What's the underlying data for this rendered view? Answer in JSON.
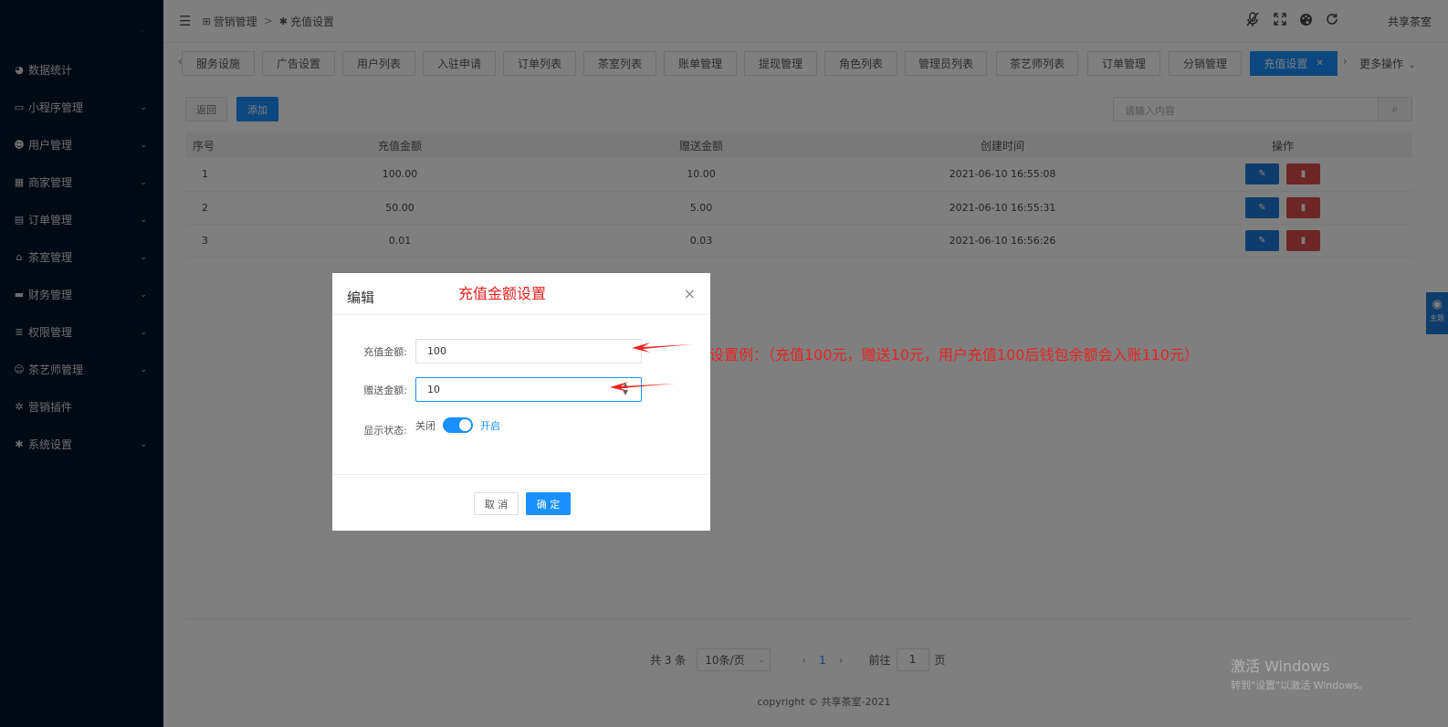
{
  "sidebar": {
    "logo_text": "·",
    "items": [
      {
        "label": "数据统计",
        "icon": "dashboard-icon",
        "glyph": "◕",
        "has_children": false
      },
      {
        "label": "小程序管理",
        "icon": "monitor-icon",
        "glyph": "▭",
        "has_children": true
      },
      {
        "label": "用户管理",
        "icon": "users-icon",
        "glyph": "☻",
        "has_children": true
      },
      {
        "label": "商家管理",
        "icon": "store-icon",
        "glyph": "▦",
        "has_children": true
      },
      {
        "label": "订单管理",
        "icon": "clipboard-icon",
        "glyph": "▤",
        "has_children": true
      },
      {
        "label": "茶室管理",
        "icon": "home-icon",
        "glyph": "⌂",
        "has_children": true
      },
      {
        "label": "财务管理",
        "icon": "credit-card-icon",
        "glyph": "▬",
        "has_children": true
      },
      {
        "label": "权限管理",
        "icon": "database-icon",
        "glyph": "≣",
        "has_children": true
      },
      {
        "label": "茶艺师管理",
        "icon": "user-tie-icon",
        "glyph": "☺",
        "has_children": true
      },
      {
        "label": "营销插件",
        "icon": "plugin-icon",
        "glyph": "✲",
        "has_children": false
      },
      {
        "label": "系统设置",
        "icon": "gear-icon",
        "glyph": "✱",
        "has_children": true
      }
    ]
  },
  "header": {
    "breadcrumb": [
      {
        "label": "营销管理",
        "icon": "sitemap-icon",
        "glyph": "⊞"
      },
      {
        "label": "充值设置",
        "icon": "gear-icon",
        "glyph": "✱"
      }
    ],
    "separator": ">",
    "user": "共享茶室",
    "icons": [
      "mic-off-icon",
      "fullscreen-icon",
      "palette-icon",
      "refresh-icon"
    ]
  },
  "tabs": {
    "items": [
      "服务设施",
      "广告设置",
      "用户列表",
      "入驻申请",
      "订单列表",
      "茶室列表",
      "账单管理",
      "提现管理",
      "角色列表",
      "管理员列表",
      "茶艺师列表",
      "订单管理",
      "分销管理",
      "充值设置"
    ],
    "active": "充值设置",
    "more": "更多操作"
  },
  "toolbar": {
    "back_label": "返回",
    "add_label": "添加",
    "search_placeholder": "请输入内容"
  },
  "table": {
    "headers": [
      "序号",
      "充值金额",
      "赠送金额",
      "创建时间",
      "操作"
    ],
    "rows": [
      {
        "no": "1",
        "amount": "100.00",
        "bonus": "10.00",
        "created": "2021-06-10 16:55:08"
      },
      {
        "no": "2",
        "amount": "50.00",
        "bonus": "5.00",
        "created": "2021-06-10 16:55:31"
      },
      {
        "no": "3",
        "amount": "0.01",
        "bonus": "0.03",
        "created": "2021-06-10 16:56:26"
      }
    ]
  },
  "pagination": {
    "total": "共 3 条",
    "page_size": "10条/页",
    "current": "1",
    "goto_label": "前往",
    "goto_value": "1",
    "page_unit": "页"
  },
  "footer": {
    "copyright": "copyright © 共享茶室-2021"
  },
  "theme_button": "主题",
  "watermark": {
    "line1": "激活 Windows",
    "line2": "转到\"设置\"以激活 Windows。"
  },
  "dialog": {
    "title": "编辑",
    "fields": {
      "amount_label": "充值金额:",
      "amount_value": "100",
      "bonus_label": "赠送金额:",
      "bonus_value": "10",
      "status_label": "显示状态:",
      "status_off": "关闭",
      "status_on": "开启",
      "status_checked": true
    },
    "cancel_label": "取 消",
    "confirm_label": "确 定"
  },
  "annotations": {
    "title": "充值金额设置",
    "note": "设置例：（充值100元，赠送10元，用户充值100后钱包余额会入账110元）",
    "color": "#e8231f"
  },
  "colors": {
    "primary": "#1890ff",
    "danger": "#dd4b4b",
    "sidebar_bg": "#001529"
  }
}
